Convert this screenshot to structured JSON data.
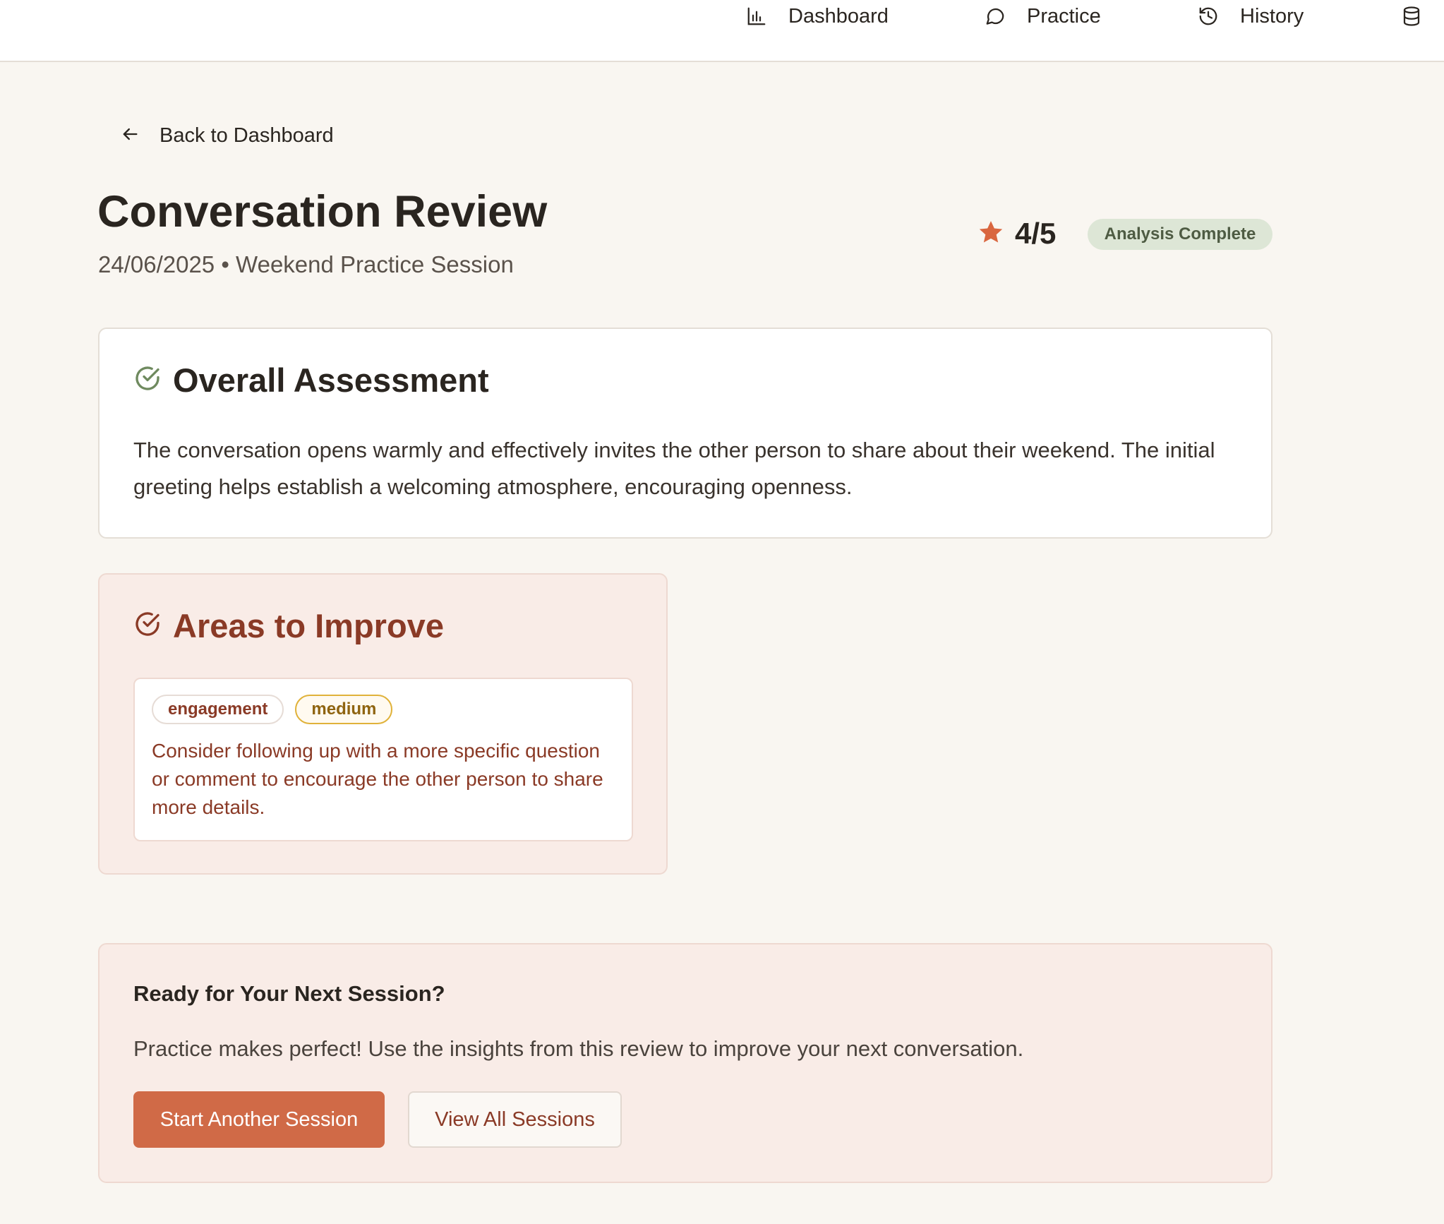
{
  "nav": {
    "items": [
      {
        "label": "Dashboard",
        "icon": "bar-chart-icon"
      },
      {
        "label": "Practice",
        "icon": "chat-bubble-icon"
      },
      {
        "label": "History",
        "icon": "history-icon"
      },
      {
        "label": "",
        "icon": "database-icon"
      }
    ]
  },
  "back": {
    "label": "Back to Dashboard",
    "icon": "arrow-left-icon"
  },
  "header": {
    "title": "Conversation Review",
    "subtitle": "24/06/2025 • Weekend Practice Session",
    "rating": "4/5",
    "rating_icon": "star-icon",
    "status": "Analysis Complete"
  },
  "assessment": {
    "heading": "Overall Assessment",
    "icon": "check-circle-icon",
    "text": "The conversation opens warmly and effectively invites the other person to share about their weekend. The initial greeting helps establish a welcoming atmosphere, encouraging openness."
  },
  "improve": {
    "heading": "Areas to Improve",
    "icon": "check-circle-icon",
    "items": [
      {
        "category": "engagement",
        "priority": "medium",
        "text": "Consider following up with a more specific question or comment to encourage the other person to share more details."
      }
    ]
  },
  "next_session": {
    "title": "Ready for Your Next Session?",
    "text": "Practice makes perfect! Use the insights from this review to improve your next conversation.",
    "primary_button": "Start Another Session",
    "secondary_button": "View All Sessions"
  },
  "colors": {
    "accent": "#d06a47",
    "background": "#f9f6f1",
    "improve_text": "#8a3a26",
    "status_badge_bg": "#dde6d6",
    "assessment_icon": "#6f8a5f",
    "star": "#d9663f"
  }
}
